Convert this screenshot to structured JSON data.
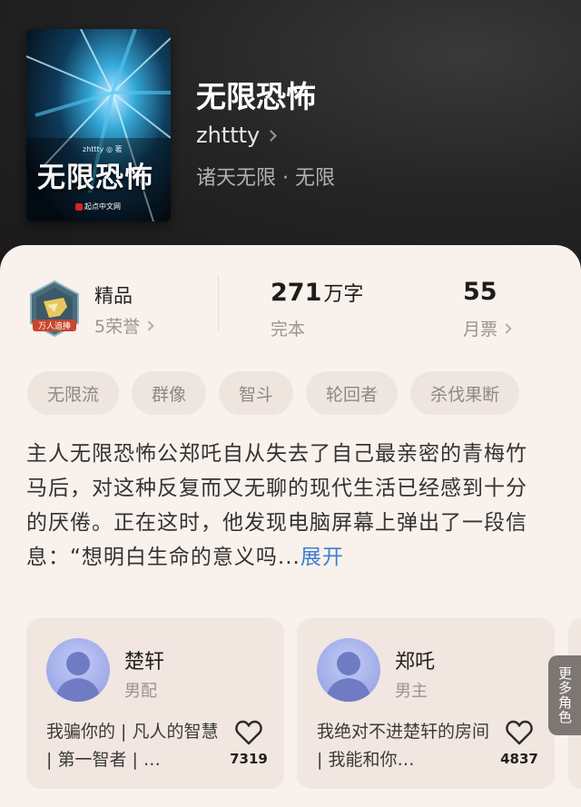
{
  "book": {
    "title": "无限恐怖",
    "author": "zhttty",
    "genre": "诸天无限 · 无限",
    "cover": {
      "title": "无限恐怖",
      "author_line": "zhttty ◎ 著",
      "publisher": "起点中文网"
    }
  },
  "stats": {
    "quality": {
      "label": "精品",
      "sub": "5荣誉",
      "badge_text": "万人追捧"
    },
    "words": {
      "value": "271",
      "unit": "万字",
      "sub": "完本"
    },
    "tickets": {
      "value": "55",
      "sub": "月票"
    }
  },
  "tags": [
    "无限流",
    "群像",
    "智斗",
    "轮回者",
    "杀伐果断"
  ],
  "intro": {
    "text": "主人无限恐怖公郑吒自从失去了自己最亲密的青梅竹马后，对这种反复而又无聊的现代生活已经感到十分的厌倦。正在这时，他发现电脑屏幕上弹出了一段信息：“想明白生命的意义吗...",
    "expand_label": "展开"
  },
  "characters": [
    {
      "name": "楚轩",
      "role": "男配",
      "desc": "我骗你的 | 凡人的智慧 | 第一智者 | …",
      "likes": "7319"
    },
    {
      "name": "郑吒",
      "role": "男主",
      "desc": "我绝对不进楚轩的房间 | 我能和你…",
      "likes": "4837"
    }
  ],
  "more_roles_label": "更多角色",
  "colors": {
    "sheet_bg": "#f9f1ec",
    "expand_link": "#3f7fd0",
    "tag_bg": "#efe5df"
  }
}
